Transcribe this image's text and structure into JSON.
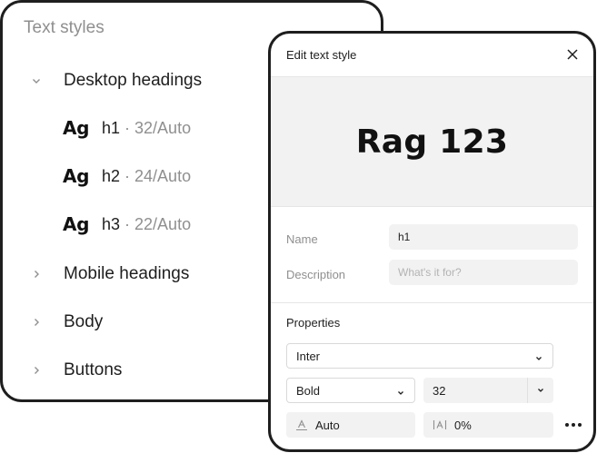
{
  "styles_list": {
    "title": "Text styles",
    "groups": [
      {
        "label": "Desktop headings",
        "expanded": true
      },
      {
        "label": "Mobile headings",
        "expanded": false
      },
      {
        "label": "Body",
        "expanded": false
      },
      {
        "label": "Buttons",
        "expanded": false
      }
    ],
    "styles": [
      {
        "sample": "Ag",
        "name": "h1",
        "meta": " · 32/Auto"
      },
      {
        "sample": "Ag",
        "name": "h2",
        "meta": " · 24/Auto"
      },
      {
        "sample": "Ag",
        "name": "h3",
        "meta": " · 22/Auto"
      }
    ]
  },
  "edit_panel": {
    "title": "Edit text style",
    "close_icon": "close-icon",
    "preview_text": "Rag 123",
    "name_label": "Name",
    "name_value": "h1",
    "description_label": "Description",
    "description_placeholder": "What's it for?",
    "properties_label": "Properties",
    "font_family": "Inter",
    "font_weight": "Bold",
    "font_size": "32",
    "line_height": "Auto",
    "letter_spacing": "0%",
    "line_height_icon": "line-height-icon",
    "letter_spacing_icon": "letter-spacing-icon",
    "more_icon": "more-icon"
  },
  "colors": {
    "border": "#1e1e1e",
    "muted_text": "#8f8f8f",
    "field_bg": "#f2f2f2",
    "preview_bg": "#f2f2f2"
  }
}
